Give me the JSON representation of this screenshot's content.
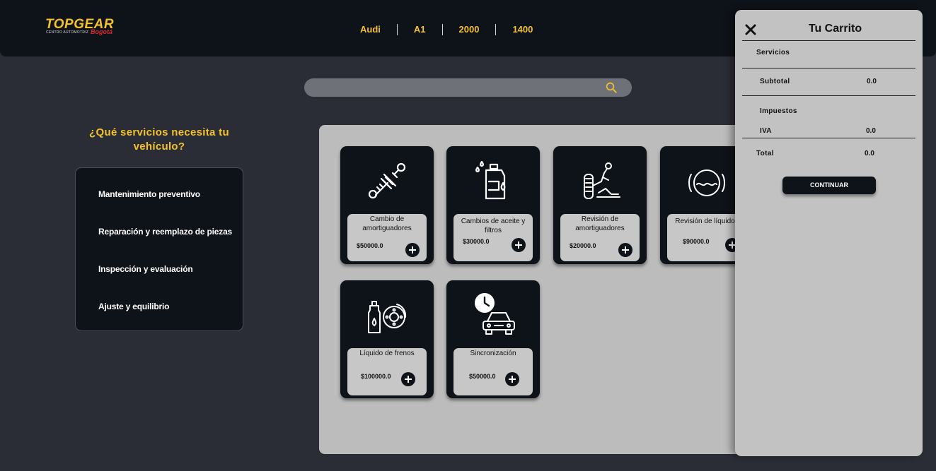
{
  "brand": {
    "name": "TOPGEAR",
    "tagline": "CENTRO AUTOMOTRIZ",
    "city": "Bogotá"
  },
  "vehicle": [
    "Audi",
    "A1",
    "2000",
    "1400"
  ],
  "search": {
    "placeholder": ""
  },
  "sidebar": {
    "title": "¿Qué servicios necesita tu vehículo?",
    "items": [
      {
        "label": "Mantenimiento preventivo"
      },
      {
        "label": "Reparación y reemplazo de piezas"
      },
      {
        "label": "Inspección y evaluación"
      },
      {
        "label": "Ajuste y equilibrio"
      }
    ]
  },
  "services": [
    {
      "title": "Cambio de amortiguadores",
      "price": "$50000.0",
      "icon": "shock-absorber-icon"
    },
    {
      "title": "Cambios de aceite y filtros",
      "price": "$30000.0",
      "icon": "oil-can-icon"
    },
    {
      "title": "Revisión de amortiguadores",
      "price": "$20000.0",
      "icon": "suspension-check-icon"
    },
    {
      "title": "Revisión de líquidos",
      "price": "$90000.0",
      "icon": "fluid-level-icon"
    },
    {
      "title": "Líquido de frenos",
      "price": "$100000.0",
      "icon": "brake-fluid-icon"
    },
    {
      "title": "Sincronización",
      "price": "$50000.0",
      "icon": "car-timing-icon"
    }
  ],
  "cart": {
    "title": "Tu Carrito",
    "services_label": "Servicios",
    "subtotal_label": "Subtotal",
    "subtotal_value": "0.0",
    "taxes_label": "Impuestos",
    "iva_label": "IVA",
    "iva_value": "0.0",
    "total_label": "Total",
    "total_value": "0.0",
    "continue_label": "CONTINUAR"
  },
  "colors": {
    "accent": "#f5c22b",
    "dark": "#0e1219",
    "background": "#2b2d36",
    "brand_red": "#e0262e"
  }
}
